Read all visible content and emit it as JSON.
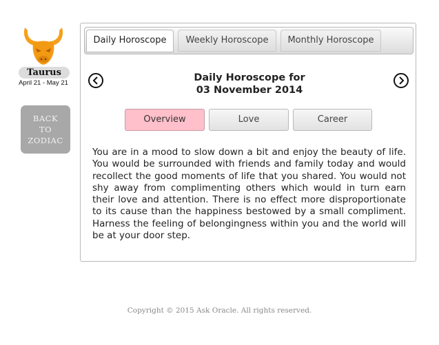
{
  "sign": {
    "name": "Taurus",
    "dates": "April 21 - May 21",
    "icon": "taurus-bull-icon",
    "icon_color": "#f5a01a"
  },
  "back_button": {
    "lines": [
      "BACK",
      "TO",
      "ZODIAC"
    ]
  },
  "tabs": [
    {
      "label": "Daily Horoscope",
      "active": true
    },
    {
      "label": "Weekly Horoscope",
      "active": false
    },
    {
      "label": "Monthly Horoscope",
      "active": false
    }
  ],
  "header": {
    "title_line1": "Daily Horoscope for",
    "title_line2": "03 November 2014",
    "prev_icon": "chevron-left-circle-icon",
    "next_icon": "chevron-right-circle-icon"
  },
  "subtabs": [
    {
      "label": "Overview",
      "active": true
    },
    {
      "label": "Love",
      "active": false
    },
    {
      "label": "Career",
      "active": false
    }
  ],
  "content": {
    "text": "You are in a mood to slow down a bit and enjoy the beauty of life. You would be surrounded with friends and family today and would recollect the good moments of life that you shared. You would not shy away from complimenting others which would in turn earn their love and attention. There is no effect more disproportionate to its cause than the happiness bestowed by a small compliment. Harness the feeling of belongingness within you and the world will be at your door step."
  },
  "footer": {
    "copyright": "Copyright © 2015 Ask Oracle. All rights reserved."
  },
  "colors": {
    "active_subtab": "#ffc0cb",
    "back_button": "#a8a8a8"
  }
}
